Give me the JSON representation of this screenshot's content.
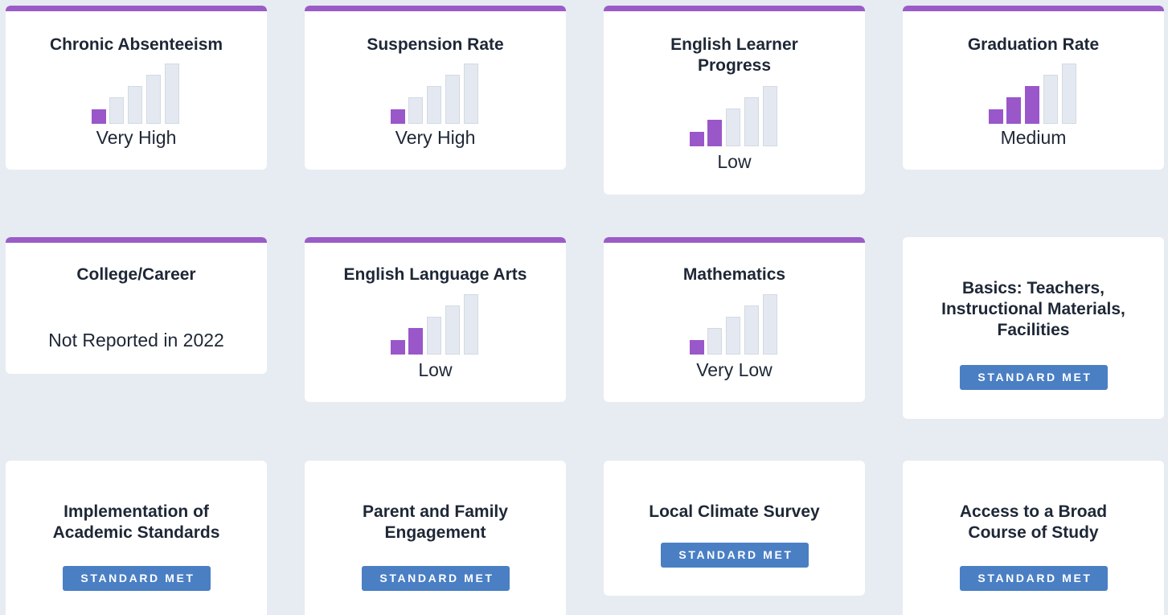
{
  "colors": {
    "page_background": "#e7ebf2",
    "card_background": "#ffffff",
    "accent_purple": "#9a5cc7",
    "bar_filled": "#9957c9",
    "bar_empty": "#e4e9f1",
    "badge_blue": "#4a7fc4"
  },
  "indicators": [
    {
      "title": "Chronic Absenteeism",
      "level": 1,
      "max_level": 5,
      "status": "Very High"
    },
    {
      "title": "Suspension Rate",
      "level": 1,
      "max_level": 5,
      "status": "Very High"
    },
    {
      "title": "English Learner Progress",
      "level": 2,
      "max_level": 5,
      "status": "Low"
    },
    {
      "title": "Graduation Rate",
      "level": 3,
      "max_level": 5,
      "status": "Medium"
    },
    {
      "title": "College/Career",
      "status": "Not Reported in 2022"
    },
    {
      "title": "English Language Arts",
      "level": 2,
      "max_level": 5,
      "status": "Low"
    },
    {
      "title": "Mathematics",
      "level": 1,
      "max_level": 5,
      "status": "Very Low"
    }
  ],
  "local_indicators": [
    {
      "title": "Basics: Teachers, Instructional Materials, Facilities",
      "badge": "STANDARD MET"
    },
    {
      "title": "Implementation of Academic Standards",
      "badge": "STANDARD MET"
    },
    {
      "title": "Parent and Family Engagement",
      "badge": "STANDARD MET"
    },
    {
      "title": "Local Climate Survey",
      "badge": "STANDARD MET"
    },
    {
      "title": "Access to a Broad Course of Study",
      "badge": "STANDARD MET"
    }
  ]
}
